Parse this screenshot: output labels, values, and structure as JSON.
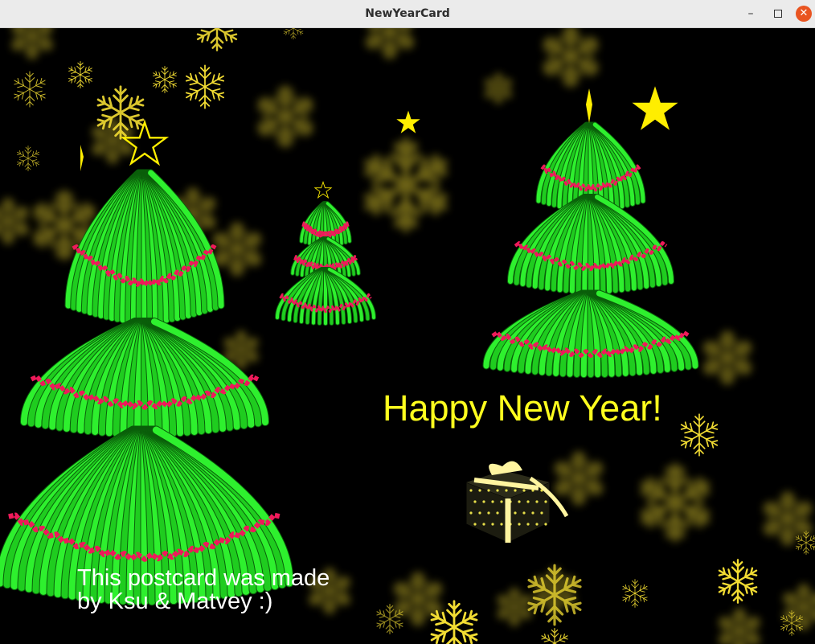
{
  "window": {
    "title": "NewYearCard",
    "minimize_icon": "minimize-icon",
    "maximize_icon": "maximize-icon",
    "close_icon": "close-icon",
    "close_color": "#e95420"
  },
  "card": {
    "greeting": "Happy New Year!",
    "credit_line1": "This postcard was made",
    "credit_line2": "by Ksu & Matvey :)",
    "colors": {
      "background": "#000000",
      "greeting": "#ffff1e",
      "credit": "#ffffff",
      "tree_green": "#1fcc1f",
      "garland": "#ee1a5a",
      "star": "#ffee00",
      "snowflake": "#f2dc33",
      "gift_box": "#1c1c10",
      "gift_ribbon": "#fff5a0"
    },
    "icons": [
      "snowflake-icon",
      "star-icon",
      "christmas-tree",
      "gift-box-icon"
    ]
  }
}
